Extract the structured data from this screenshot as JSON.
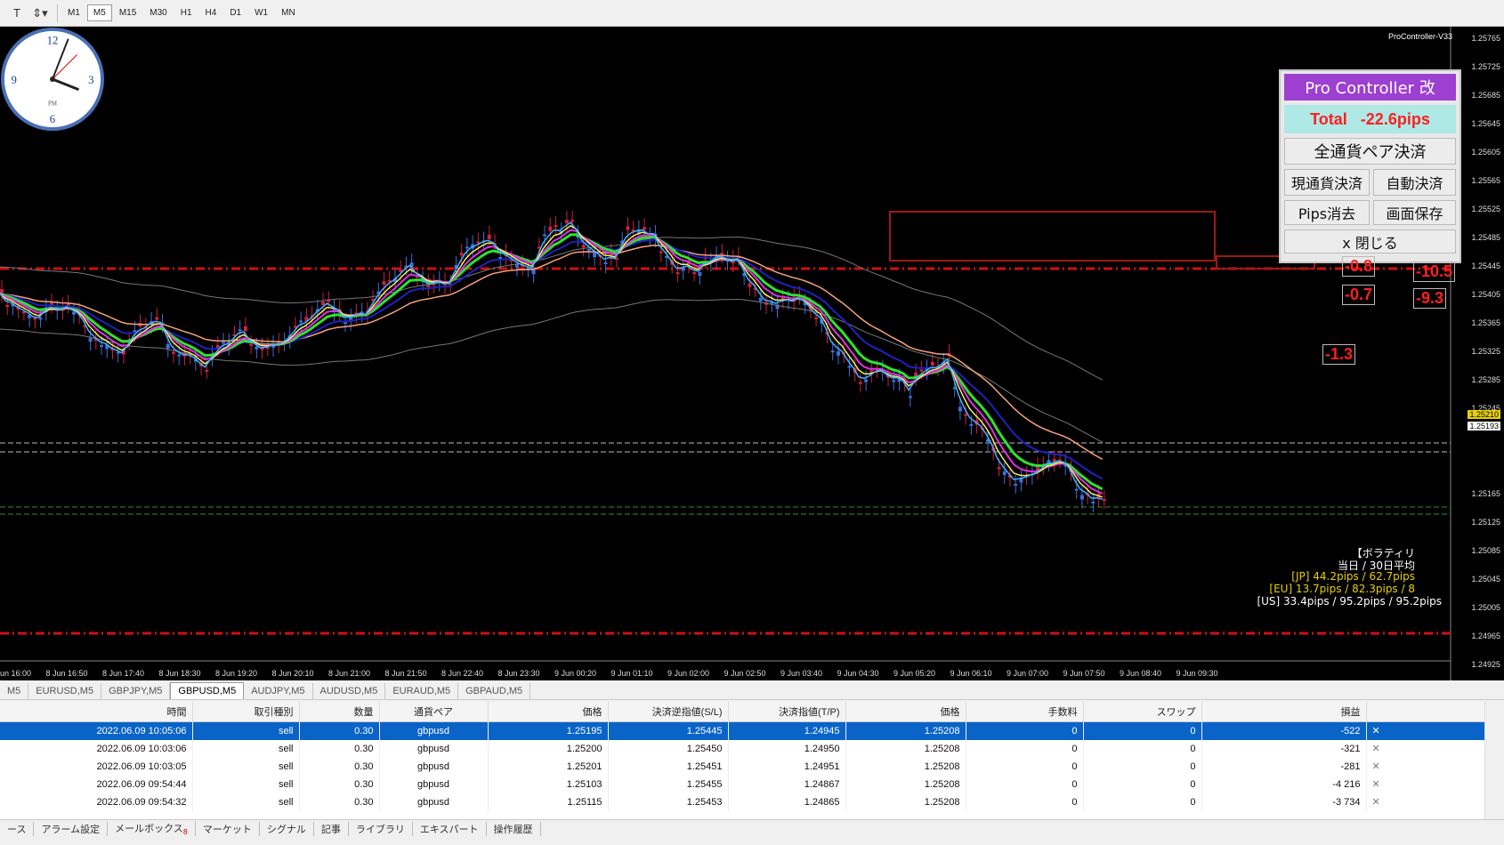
{
  "toolbar": {
    "timeframes": [
      "M1",
      "M5",
      "M15",
      "M30",
      "H1",
      "H4",
      "D1",
      "W1",
      "MN"
    ],
    "active_timeframe": "M5"
  },
  "chart": {
    "indicator_label": "ProController-V33",
    "price_labels": [
      "1.25765",
      "1.25725",
      "1.25685",
      "1.25645",
      "1.25605",
      "1.25565",
      "1.25525",
      "1.25485",
      "1.25445",
      "1.25405",
      "1.25365",
      "1.25325",
      "1.25285",
      "1.25245",
      "1.25210",
      "1.25193",
      "1.25165",
      "1.25125",
      "1.25085",
      "1.25045",
      "1.25005",
      "1.24965",
      "1.24925"
    ],
    "time_labels": [
      "8 Jun 16:00",
      "8 Jun 16:50",
      "8 Jun 17:40",
      "8 Jun 18:30",
      "8 Jun 19:20",
      "8 Jun 20:10",
      "8 Jun 21:00",
      "8 Jun 21:50",
      "8 Jun 22:40",
      "8 Jun 23:30",
      "9 Jun 00:20",
      "9 Jun 01:10",
      "9 Jun 02:00",
      "9 Jun 02:50",
      "9 Jun 03:40",
      "9 Jun 04:30",
      "9 Jun 05:20",
      "9 Jun 06:10",
      "9 Jun 07:00",
      "9 Jun 07:50",
      "9 Jun 08:40",
      "9 Jun 09:30"
    ],
    "bid_price": "1.25210",
    "ask_price": "1.25193"
  },
  "pro_controller": {
    "title": "Pro Controller 改",
    "total": "Total   -22.6pips",
    "close_all": "全通貨ペア決済",
    "close_current": "現通貨決済",
    "auto_close": "自動決済",
    "clear_pips": "Pips消去",
    "save_screen": "画面保存",
    "close": "x 閉じる",
    "colors": {
      "title_bg": "#9d3fd0",
      "total_bg": "#aee9e6",
      "total_text": "#ff2020"
    }
  },
  "pips_boxes": [
    "-0.8",
    "-10.5",
    "-0.7",
    "-9.3",
    "-1.3"
  ],
  "volatility": {
    "title": "【ボラティリ",
    "subtitle": "当日 / 30日平均",
    "jp": "[JP] 44.2pips / 62.7pips",
    "eu": "[EU] 13.7pips / 82.3pips / 8",
    "us": "[US] 33.4pips / 95.2pips / 95.2pips"
  },
  "symbol_tabs": [
    "M5",
    "EURUSD,M5",
    "GBPJPY,M5",
    "GBPUSD,M5",
    "AUDJPY,M5",
    "AUDUSD,M5",
    "EURAUD,M5",
    "GBPAUD,M5"
  ],
  "active_symbol_tab": "GBPUSD,M5",
  "trades": {
    "headers": [
      "時間",
      "取引種別",
      "数量",
      "通貨ペア",
      "価格",
      "決済逆指値(S/L)",
      "決済指値(T/P)",
      "価格",
      "手数料",
      "スワップ",
      "損益"
    ],
    "rows": [
      [
        "2022.06.09 10:05:06",
        "sell",
        "0.30",
        "gbpusd",
        "1.25195",
        "1.25445",
        "1.24945",
        "1.25208",
        "0",
        "0",
        "-522"
      ],
      [
        "2022.06.09 10:03:06",
        "sell",
        "0.30",
        "gbpusd",
        "1.25200",
        "1.25450",
        "1.24950",
        "1.25208",
        "0",
        "0",
        "-321"
      ],
      [
        "2022.06.09 10:03:05",
        "sell",
        "0.30",
        "gbpusd",
        "1.25201",
        "1.25451",
        "1.24951",
        "1.25208",
        "0",
        "0",
        "-281"
      ],
      [
        "2022.06.09 09:54:44",
        "sell",
        "0.30",
        "gbpusd",
        "1.25103",
        "1.25455",
        "1.24867",
        "1.25208",
        "0",
        "0",
        "-4 216"
      ],
      [
        "2022.06.09 09:54:32",
        "sell",
        "0.30",
        "gbpusd",
        "1.25115",
        "1.25453",
        "1.24865",
        "1.25208",
        "0",
        "0",
        "-3 734"
      ]
    ]
  },
  "bottom_tabs": [
    "ース",
    "アラーム設定",
    "メールボックス",
    "マーケット",
    "シグナル",
    "記事",
    "ライブラリ",
    "エキスパート",
    "操作履歴"
  ],
  "mailbox_count": "8"
}
